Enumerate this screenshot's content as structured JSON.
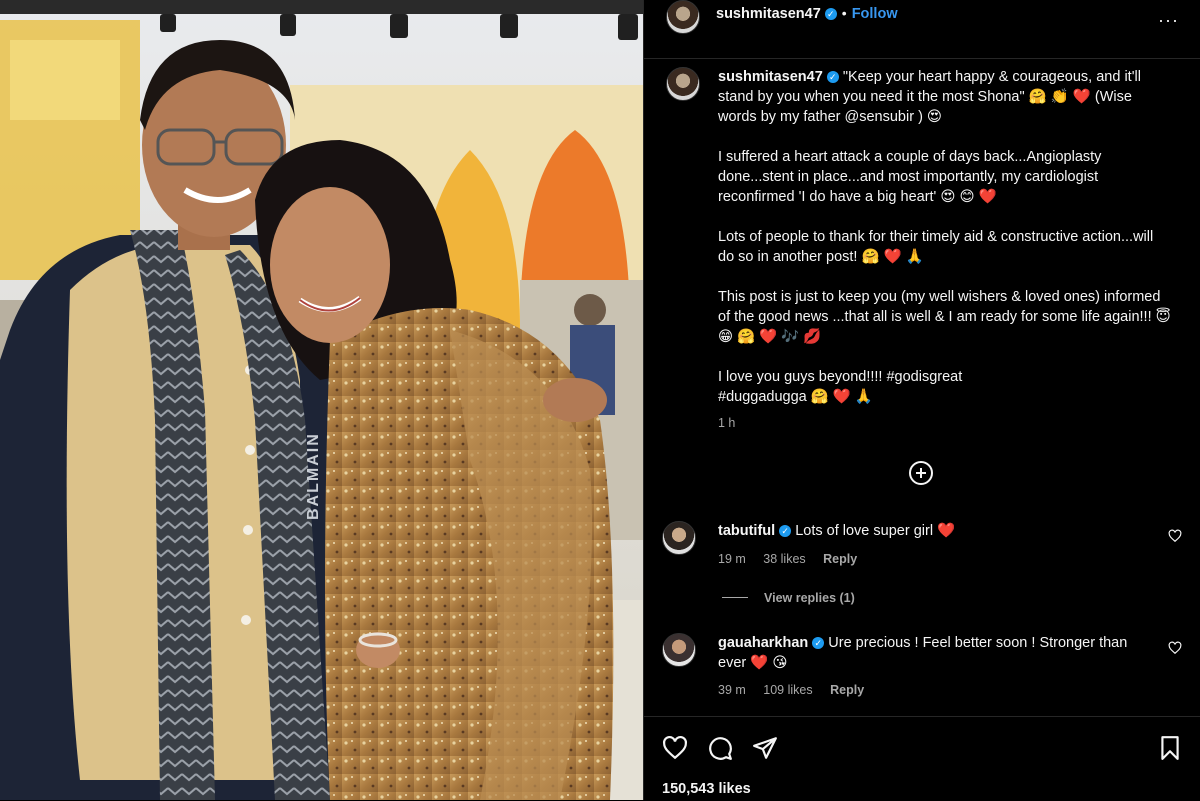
{
  "post": {
    "author": "sushmitasen47",
    "follow_label": "Follow",
    "separator": "•",
    "more_label": "···"
  },
  "caption": {
    "author": "sushmitasen47",
    "paragraphs": [
      "\"Keep your heart happy & courageous, and it'll stand by you when you need it the most Shona\" 🤗 👏 ❤️ (Wise words by my father @sensubir ) 😍",
      "I suffered a heart attack a couple of days back...Angioplasty done...stent in place...and most importantly, my cardiologist reconfirmed 'I do have a big heart' 😍 😊 ❤️",
      "Lots of people to thank for their timely aid & constructive action...will do so in another post! 🤗 ❤️ 🙏",
      "This post is just to keep you (my well wishers & loved ones) informed of the good news ...that all is well & I am ready for some life again!!! 😇 😁 🤗 ❤️ 🎶 💋",
      "I love you guys beyond!!!! #godisgreat\n#duggadugga 🤗 ❤️ 🙏"
    ],
    "time": "1 h"
  },
  "comments": [
    {
      "user": "tabutiful",
      "text": "Lots of love super girl ❤️",
      "time": "19 m",
      "likes": "38 likes",
      "reply": "Reply"
    },
    {
      "user": "gauaharkhan",
      "text": "Ure precious ! Feel better soon ! Stronger than ever ❤️ 😘",
      "time": "39 m",
      "likes": "109 likes",
      "reply": "Reply"
    }
  ],
  "view_replies": "View replies (1)",
  "likes_count": "150,543 likes",
  "photo_text": {
    "scarf_text": "BALMAIN"
  },
  "colors": {
    "background": "#000000",
    "accent": "#3897f0",
    "verified": "#1d9bf0",
    "heart": "#ed4956"
  },
  "icons": {
    "like": "heart-outline-icon",
    "comment": "comment-bubble-icon",
    "share": "paper-plane-icon",
    "save": "bookmark-icon",
    "add": "add-circle-icon",
    "more": "more-dots-icon"
  }
}
